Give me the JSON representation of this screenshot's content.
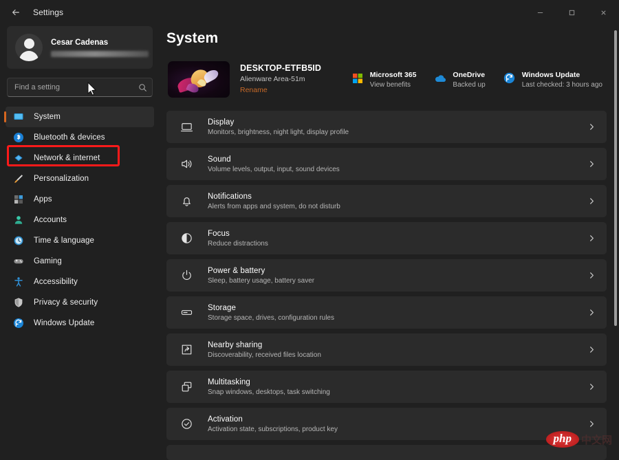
{
  "titlebar": {
    "back_icon": "back-arrow-icon",
    "title": "Settings",
    "minimize_label": "−",
    "maximize_label": "❐",
    "close_label": "×"
  },
  "sidebar": {
    "user": {
      "name": "Cesar Cadenas",
      "email_redacted": true,
      "avatar_icon": "account-avatar-icon"
    },
    "search": {
      "placeholder": "Find a setting",
      "value": "",
      "icon": "search-icon"
    },
    "items": [
      {
        "label": "System",
        "icon": "monitor-icon",
        "active": true,
        "annotated": false
      },
      {
        "label": "Bluetooth & devices",
        "icon": "bluetooth-icon",
        "active": false,
        "annotated": true
      },
      {
        "label": "Network & internet",
        "icon": "wifi-icon",
        "active": false,
        "annotated": false
      },
      {
        "label": "Personalization",
        "icon": "paintbrush-icon",
        "active": false,
        "annotated": false
      },
      {
        "label": "Apps",
        "icon": "apps-grid-icon",
        "active": false,
        "annotated": false
      },
      {
        "label": "Accounts",
        "icon": "person-icon",
        "active": false,
        "annotated": false
      },
      {
        "label": "Time & language",
        "icon": "clock-icon",
        "active": false,
        "annotated": false
      },
      {
        "label": "Gaming",
        "icon": "gamepad-icon",
        "active": false,
        "annotated": false
      },
      {
        "label": "Accessibility",
        "icon": "accessibility-icon",
        "active": false,
        "annotated": false
      },
      {
        "label": "Privacy & security",
        "icon": "shield-icon",
        "active": false,
        "annotated": false
      },
      {
        "label": "Windows Update",
        "icon": "update-refresh-icon",
        "active": false,
        "annotated": false
      }
    ]
  },
  "main": {
    "page_title": "System",
    "device": {
      "name": "DESKTOP-ETFB5ID",
      "model": "Alienware Area-51m",
      "rename_label": "Rename",
      "thumbnail_icon": "windows-bloom-wallpaper-thumbnail"
    },
    "status": [
      {
        "title": "Microsoft 365",
        "subtitle": "View benefits",
        "icon": "microsoft-365-icon"
      },
      {
        "title": "OneDrive",
        "subtitle": "Backed up",
        "icon": "onedrive-cloud-icon"
      },
      {
        "title": "Windows Update",
        "subtitle": "Last checked: 3 hours ago",
        "icon": "update-refresh-icon"
      }
    ],
    "rows": [
      {
        "title": "Display",
        "subtitle": "Monitors, brightness, night light, display profile",
        "icon": "display-monitor-icon"
      },
      {
        "title": "Sound",
        "subtitle": "Volume levels, output, input, sound devices",
        "icon": "speaker-icon"
      },
      {
        "title": "Notifications",
        "subtitle": "Alerts from apps and system, do not disturb",
        "icon": "bell-icon"
      },
      {
        "title": "Focus",
        "subtitle": "Reduce distractions",
        "icon": "focus-moon-icon"
      },
      {
        "title": "Power & battery",
        "subtitle": "Sleep, battery usage, battery saver",
        "icon": "power-icon"
      },
      {
        "title": "Storage",
        "subtitle": "Storage space, drives, configuration rules",
        "icon": "storage-drive-icon"
      },
      {
        "title": "Nearby sharing",
        "subtitle": "Discoverability, received files location",
        "icon": "share-icon"
      },
      {
        "title": "Multitasking",
        "subtitle": "Snap windows, desktops, task switching",
        "icon": "multitasking-windows-icon"
      },
      {
        "title": "Activation",
        "subtitle": "Activation state, subscriptions, product key",
        "icon": "check-circle-icon"
      }
    ],
    "chevron_icon": "chevron-right-icon"
  },
  "watermark": {
    "brand": "php",
    "suffix": "中文网"
  },
  "colors": {
    "window_bg": "#202020",
    "card_bg": "#2b2b2b",
    "accent_orange": "#d6661f",
    "annotation_red": "#fd1a1a",
    "link_orange": "#c96a28"
  }
}
